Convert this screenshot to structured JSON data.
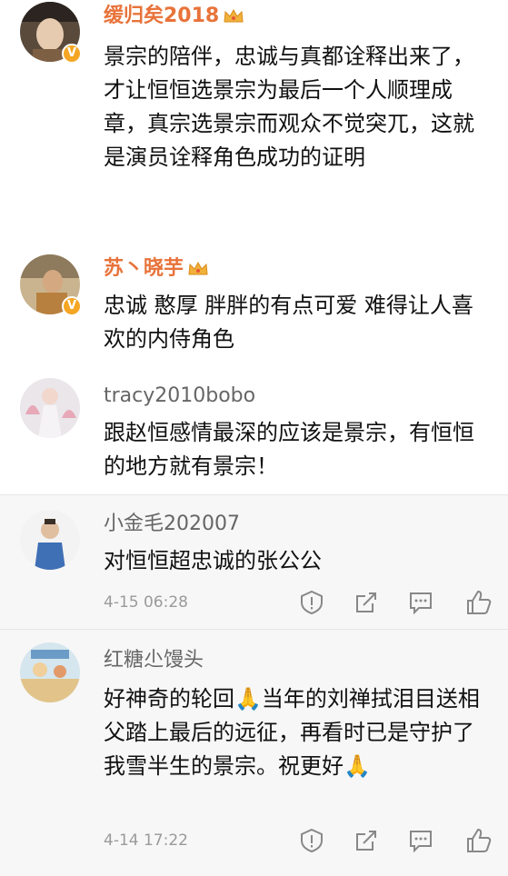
{
  "comments": [
    {
      "username": "缓归矣2018",
      "text": "景宗的陪伴，忠诚与真都诠释出来了，才让恒恒选景宗为最后一个人顺理成章，真宗选景宗而观众不觉突兀，这就是演员诠释角色成功的证明"
    },
    {
      "username": "苏丶晓芋",
      "text": "忠诚 憨厚 胖胖的有点可爱 难得让人喜欢的内侍角色"
    },
    {
      "username": "tracy2010bobo",
      "text": "跟赵恒感情最深的应该是景宗，有恒恒的地方就有景宗！"
    },
    {
      "username": "小金毛202007",
      "text": "对恒恒超忠诚的张公公",
      "time": "4-15 06:28"
    },
    {
      "username": "红糖尐馒头",
      "text": "好神奇的轮回🙏当年的刘禅拭泪目送相父踏上最后的远征，再看时已是守护了我雪半生的景宗。祝更好🙏",
      "time": "4-14 17:22"
    }
  ],
  "actions": [
    "report-icon",
    "share-icon",
    "comment-icon",
    "like-icon"
  ],
  "colors": {
    "vip_name": "#e8733a",
    "normal_name": "#666666",
    "time": "#9a9a9a",
    "verified": "#f5a623"
  }
}
